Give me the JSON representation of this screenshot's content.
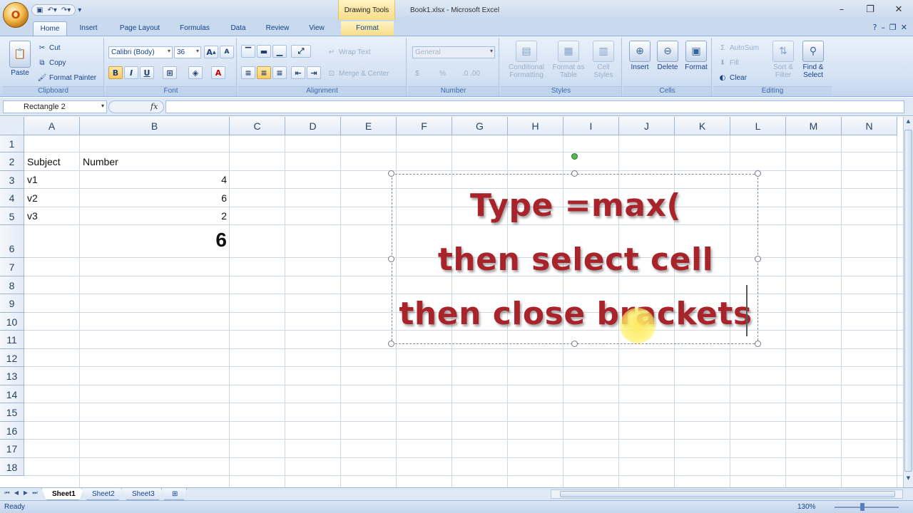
{
  "window": {
    "context_tab": "Drawing Tools",
    "title": "Book1.xlsx - Microsoft Excel",
    "office_logo": "O"
  },
  "tabs": [
    "Home",
    "Insert",
    "Page Layout",
    "Formulas",
    "Data",
    "Review",
    "View",
    "Format"
  ],
  "ribbon": {
    "clipboard": {
      "paste": "Paste",
      "cut": "Cut",
      "copy": "Copy",
      "format_painter": "Format Painter",
      "label": "Clipboard"
    },
    "font": {
      "name": "Calibri (Body)",
      "size": "36",
      "label": "Font"
    },
    "alignment": {
      "wrap_text": "Wrap Text",
      "merge_center": "Merge & Center",
      "label": "Alignment"
    },
    "number": {
      "format": "General",
      "currency": "$",
      "percent": "%",
      "label": "Number"
    },
    "styles": {
      "conditional": "Conditional Formatting",
      "format_table": "Format as Table",
      "cell_styles": "Cell Styles",
      "label": "Styles"
    },
    "cells": {
      "insert": "Insert",
      "delete": "Delete",
      "format": "Format",
      "label": "Cells"
    },
    "editing": {
      "autosum": "AutoSum",
      "fill": "Fill",
      "clear": "Clear",
      "sort_filter": "Sort & Filter",
      "find_select": "Find & Select",
      "label": "Editing"
    }
  },
  "formula_bar": {
    "name_box": "Rectangle 2",
    "fx": "fx",
    "value": ""
  },
  "columns": [
    "A",
    "B",
    "C",
    "D",
    "E",
    "F",
    "G",
    "H",
    "I",
    "J",
    "K",
    "L",
    "M",
    "N"
  ],
  "rows": [
    "1",
    "2",
    "3",
    "4",
    "5",
    "6",
    "7",
    "8",
    "9",
    "10",
    "11",
    "12",
    "13",
    "14",
    "15",
    "16",
    "17",
    "18"
  ],
  "cells": {
    "A2": "Subject",
    "B2": "Number",
    "A3": "v1",
    "B3": "4",
    "A4": "v2",
    "B4": "6",
    "A5": "v3",
    "B5": "2",
    "B6": "6"
  },
  "shape": {
    "line1": "Type =max(",
    "line2": "then select cell",
    "line3": "then close brackets"
  },
  "sheets": [
    "Sheet1",
    "Sheet2",
    "Sheet3"
  ],
  "status": {
    "mode": "Ready",
    "zoom": "130%"
  },
  "colors": {
    "shape_text": "#a8232a",
    "ribbon_bg": "#d3e1f3",
    "highlight": "#ffe95a"
  }
}
